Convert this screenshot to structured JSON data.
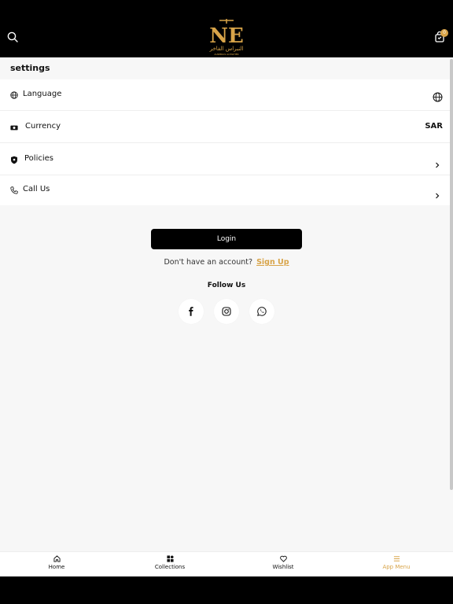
{
  "header": {
    "cart_count": "0",
    "logo": {
      "letters": "NE",
      "arabic_text": "النبراس الفاخر",
      "latin_text": "ALNIBRAS ALFAKHER"
    }
  },
  "settings": {
    "title": "settings",
    "rows": [
      {
        "label": "Language",
        "icon": "globe-icon",
        "right_icon": "globe-icon"
      },
      {
        "label": "Currency",
        "icon": "money-icon",
        "value": "SAR"
      },
      {
        "label": "Policies",
        "icon": "shield-icon",
        "right_icon": "chevron-right-icon"
      },
      {
        "label": "Call Us",
        "icon": "phone-icon",
        "right_icon": "chevron-right-icon"
      }
    ]
  },
  "auth": {
    "login_label": "Login",
    "no_account_text": "Don't have an account?",
    "signup_label": "Sign Up"
  },
  "follow": {
    "title": "Follow Us",
    "social": [
      "facebook-icon",
      "instagram-icon",
      "whatsapp-icon"
    ]
  },
  "bottom_nav": {
    "items": [
      {
        "label": "Home",
        "icon": "home-icon"
      },
      {
        "label": "Collections",
        "icon": "grid-icon"
      },
      {
        "label": "Wishlist",
        "icon": "heart-icon"
      },
      {
        "label": "App Menu",
        "icon": "menu-icon"
      }
    ],
    "active": "App Menu"
  },
  "colors": {
    "accent": "#d8a449",
    "header_bg": "#000000",
    "page_bg": "#f7f7f7"
  }
}
